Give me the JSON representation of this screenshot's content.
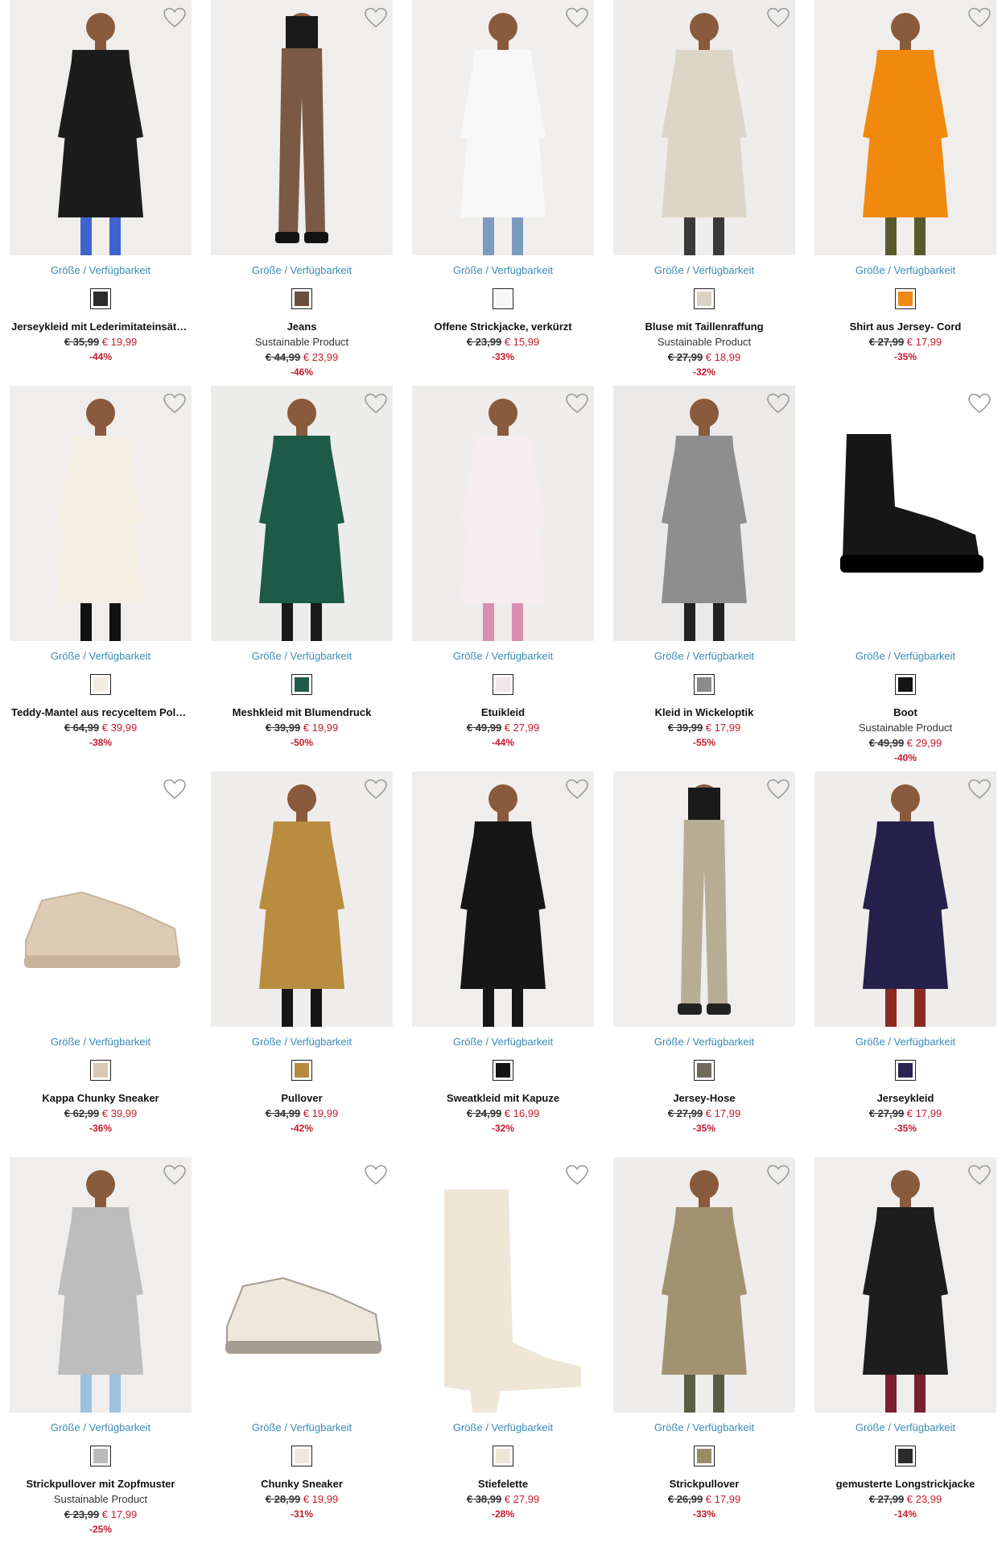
{
  "availability_label": "Größe / Verfügbarkeit",
  "products": [
    {
      "name": "Jerseykleid mit Lederimitateinsätzen",
      "sub": "",
      "old_price": "€ 35,99",
      "new_price": "€ 19,99",
      "discount": "-44%",
      "swatch": "#2b2b2b",
      "bg": "#f0eeeb",
      "figure": "#1c1c1c",
      "accent": "#3e63cf"
    },
    {
      "name": "Jeans",
      "sub": "Sustainable Product",
      "old_price": "€ 44,99",
      "new_price": "€ 23,99",
      "discount": "-46%",
      "swatch": "#6b5040",
      "bg": "#efeeec",
      "figure": "#7a5a45",
      "accent": "#111111"
    },
    {
      "name": "Offene Strickjacke, verkürzt",
      "sub": "",
      "old_price": "€ 23,99",
      "new_price": "€ 15,99",
      "discount": "-33%",
      "swatch": "#f6f6f6",
      "bg": "#f0efed",
      "figure": "#f8f8f8",
      "accent": "#7d9bbf"
    },
    {
      "name": "Bluse mit Taillenraffung",
      "sub": "Sustainable Product",
      "old_price": "€ 27,99",
      "new_price": "€ 18,99",
      "discount": "-32%",
      "swatch": "#d9d2c5",
      "bg": "#eeedeb",
      "figure": "#ddd5c8",
      "accent": "#3a3a3a"
    },
    {
      "name": "Shirt aus Jersey- Cord",
      "sub": "",
      "old_price": "€ 27,99",
      "new_price": "€ 17,99",
      "discount": "-35%",
      "swatch": "#f08a14",
      "bg": "#efeeec",
      "figure": "#f2890f",
      "accent": "#585a2c"
    },
    {
      "name": "Teddy-Mantel aus recyceltem Polye…",
      "sub": "",
      "old_price": "€ 64,99",
      "new_price": "€ 39,99",
      "discount": "-38%",
      "swatch": "#f2ede0",
      "bg": "#efeeec",
      "figure": "#f3eee2",
      "accent": "#111111"
    },
    {
      "name": "Meshkleid mit Blumendruck",
      "sub": "",
      "old_price": "€ 39,99",
      "new_price": "€ 19,99",
      "discount": "-50%",
      "swatch": "#1f5a4a",
      "bg": "#ececea",
      "figure": "#1e5a48",
      "accent": "#1a1a1a"
    },
    {
      "name": "Etuikleid",
      "sub": "",
      "old_price": "€ 49,99",
      "new_price": "€ 27,99",
      "discount": "-44%",
      "swatch": "#f1e6ea",
      "bg": "#eeedeb",
      "figure": "#f4ecef",
      "accent": "#d88fb0"
    },
    {
      "name": "Kleid in Wickeloptik",
      "sub": "",
      "old_price": "€ 39,99",
      "new_price": "€ 17,99",
      "discount": "-55%",
      "swatch": "#8a8a8a",
      "bg": "#eceae8",
      "figure": "#8e8e8e",
      "accent": "#222222"
    },
    {
      "name": "Boot",
      "sub": "Sustainable Product",
      "old_price": "€ 49,99",
      "new_price": "€ 29,99",
      "discount": "-40%",
      "swatch": "#151515",
      "bg": "#ffffff",
      "figure": "#161616",
      "accent": "#161616"
    },
    {
      "name": "Kappa Chunky Sneaker",
      "sub": "",
      "old_price": "€ 62,99",
      "new_price": "€ 39,99",
      "discount": "-36%",
      "swatch": "#d9c8b4",
      "bg": "#ffffff",
      "figure": "#ddcbb6",
      "accent": "#c9b39b"
    },
    {
      "name": "Pullover",
      "sub": "",
      "old_price": "€ 34,99",
      "new_price": "€ 19,99",
      "discount": "-42%",
      "swatch": "#b88a3e",
      "bg": "#eeedeb",
      "figure": "#b98c3f",
      "accent": "#151515"
    },
    {
      "name": "Sweatkleid mit Kapuze",
      "sub": "",
      "old_price": "€ 24,99",
      "new_price": "€ 16,99",
      "discount": "-32%",
      "swatch": "#141414",
      "bg": "#efeeec",
      "figure": "#161616",
      "accent": "#161616"
    },
    {
      "name": "Jersey-Hose",
      "sub": "",
      "old_price": "€ 27,99",
      "new_price": "€ 17,99",
      "discount": "-35%",
      "swatch": "#6e6a5c",
      "bg": "#efeeec",
      "figure": "#b7ad95",
      "accent": "#222222"
    },
    {
      "name": "Jerseykleid",
      "sub": "",
      "old_price": "€ 27,99",
      "new_price": "€ 17,99",
      "discount": "-35%",
      "swatch": "#2a2450",
      "bg": "#eeedeb",
      "figure": "#25214a",
      "accent": "#8c2a22"
    },
    {
      "name": "Strickpullover mit Zopfmuster",
      "sub": "Sustainable Product",
      "old_price": "€ 23,99",
      "new_price": "€ 17,99",
      "discount": "-25%",
      "swatch": "#b9b9b9",
      "bg": "#efeeec",
      "figure": "#bdbdbd",
      "accent": "#9ec1e0"
    },
    {
      "name": "Chunky Sneaker",
      "sub": "",
      "old_price": "€ 28,99",
      "new_price": "€ 19,99",
      "discount": "-31%",
      "swatch": "#ece6dc",
      "bg": "#ffffff",
      "figure": "#eee7dc",
      "accent": "#a59c92"
    },
    {
      "name": "Stiefelette",
      "sub": "",
      "old_price": "€ 38,99",
      "new_price": "€ 27,99",
      "discount": "-28%",
      "swatch": "#eee5d6",
      "bg": "#ffffff",
      "figure": "#efe6d6",
      "accent": "#e4d9c7"
    },
    {
      "name": "Strickpullover",
      "sub": "",
      "old_price": "€ 26,99",
      "new_price": "€ 17,99",
      "discount": "-33%",
      "swatch": "#9a8a68",
      "bg": "#eeedeb",
      "figure": "#a39272",
      "accent": "#5a5e45"
    },
    {
      "name": "gemusterte Longstrickjacke",
      "sub": "",
      "old_price": "€ 27,99",
      "new_price": "€ 23,99",
      "discount": "-14%",
      "swatch": "#2b2b2b",
      "bg": "#efeeec",
      "figure": "#1d1d1d",
      "accent": "#7a2030"
    }
  ]
}
